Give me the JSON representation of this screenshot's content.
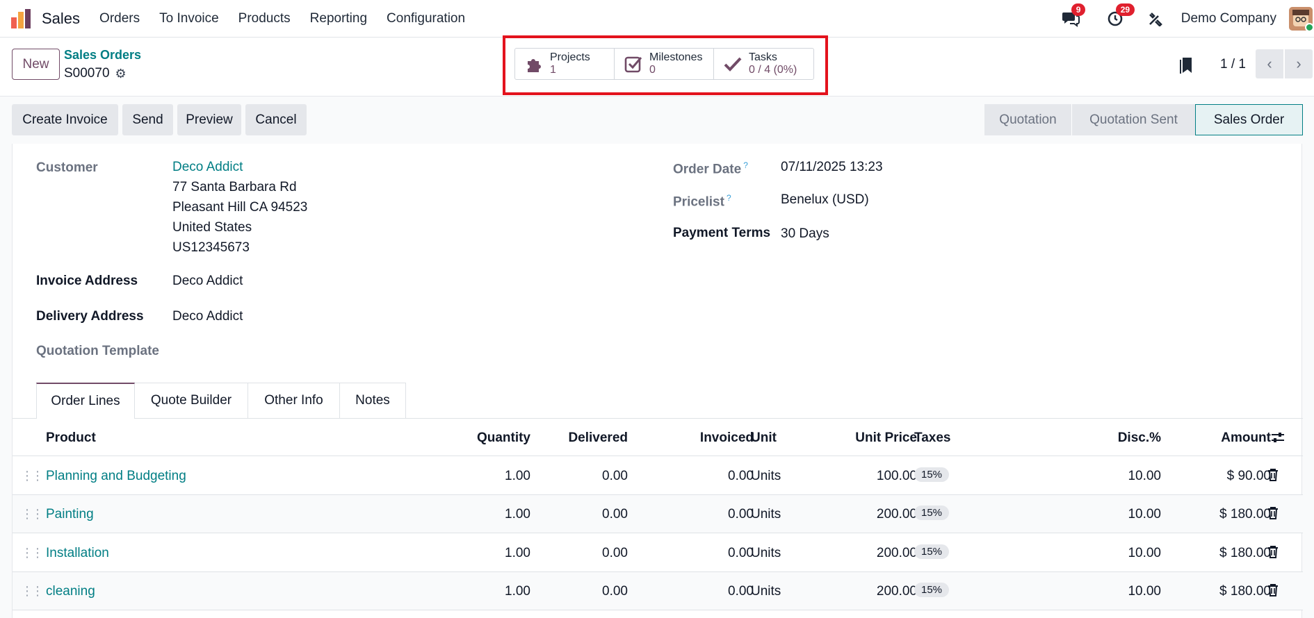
{
  "nav": {
    "app_name": "Sales",
    "menu": [
      "Orders",
      "To Invoice",
      "Products",
      "Reporting",
      "Configuration"
    ],
    "messages_count": "9",
    "activities_count": "29",
    "company": "Demo Company"
  },
  "control": {
    "new_label": "New",
    "breadcrumb_parent": "Sales Orders",
    "record_name": "S00070",
    "smart_buttons": [
      {
        "label": "Projects",
        "value": "1",
        "icon": "puzzle-icon"
      },
      {
        "label": "Milestones",
        "value": "0",
        "icon": "checkbox-icon"
      },
      {
        "label": "Tasks",
        "value": "0 / 4 (0%)",
        "icon": "check-icon"
      }
    ],
    "pager": "1 / 1"
  },
  "actions": [
    "Create Invoice",
    "Send",
    "Preview",
    "Cancel"
  ],
  "stages": [
    "Quotation",
    "Quotation Sent",
    "Sales Order"
  ],
  "active_stage": "Sales Order",
  "form": {
    "customer_label": "Customer",
    "customer_name": "Deco Addict",
    "customer_address": [
      "77 Santa Barbara Rd",
      "Pleasant Hill CA 94523",
      "United States",
      "US12345673"
    ],
    "invoice_address_label": "Invoice Address",
    "invoice_address": "Deco Addict",
    "delivery_address_label": "Delivery Address",
    "delivery_address": "Deco Addict",
    "quotation_template_label": "Quotation Template",
    "order_date_label": "Order Date",
    "order_date": "07/11/2025 13:23",
    "pricelist_label": "Pricelist",
    "pricelist": "Benelux (USD)",
    "payment_terms_label": "Payment Terms",
    "payment_terms": "30 Days",
    "help_mark": "?"
  },
  "tabs": [
    "Order Lines",
    "Quote Builder",
    "Other Info",
    "Notes"
  ],
  "table": {
    "headers": [
      "Product",
      "Quantity",
      "Delivered",
      "Invoiced",
      "Unit",
      "Unit Price",
      "Taxes",
      "Disc.%",
      "Amount"
    ],
    "rows": [
      {
        "product": "Planning and Budgeting",
        "quantity": "1.00",
        "delivered": "0.00",
        "invoiced": "0.00",
        "unit": "Units",
        "unit_price": "100.00",
        "taxes": "15%",
        "discount": "10.00",
        "amount": "$ 90.00"
      },
      {
        "product": "Painting",
        "quantity": "1.00",
        "delivered": "0.00",
        "invoiced": "0.00",
        "unit": "Units",
        "unit_price": "200.00",
        "taxes": "15%",
        "discount": "10.00",
        "amount": "$ 180.00"
      },
      {
        "product": "Installation",
        "quantity": "1.00",
        "delivered": "0.00",
        "invoiced": "0.00",
        "unit": "Units",
        "unit_price": "200.00",
        "taxes": "15%",
        "discount": "10.00",
        "amount": "$ 180.00"
      },
      {
        "product": "cleaning",
        "quantity": "1.00",
        "delivered": "0.00",
        "invoiced": "0.00",
        "unit": "Units",
        "unit_price": "200.00",
        "taxes": "15%",
        "discount": "10.00",
        "amount": "$ 180.00"
      }
    ]
  },
  "colors": {
    "brand": "#714b67",
    "link": "#017e84",
    "highlight": "#e3121d",
    "badge": "#e0202e"
  }
}
